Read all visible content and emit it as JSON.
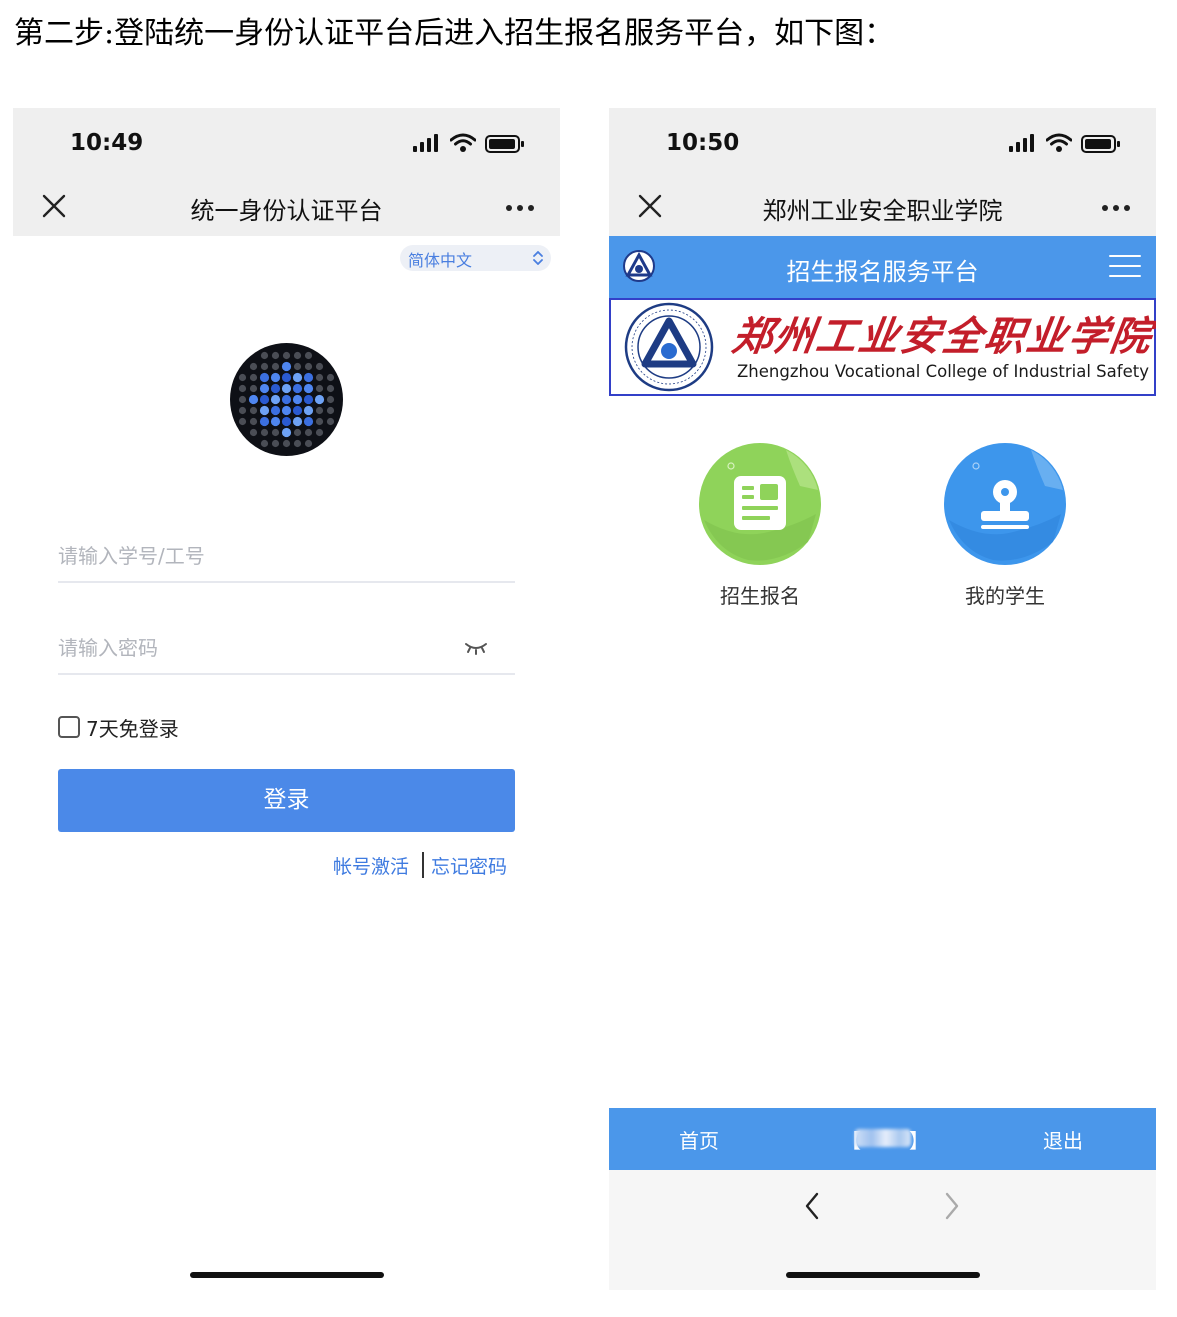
{
  "caption": "第二步:登陆统一身份认证平台后进入招生报名服务平台，如下图：",
  "left_phone": {
    "status_time": "10:49",
    "nav_title": "统一身份认证平台",
    "language": "简体中文",
    "username_placeholder": "请输入学号/工号",
    "password_placeholder": "请输入密码",
    "remember_label": "7天免登录",
    "login_label": "登录",
    "link_activate": "帐号激活",
    "link_forgot": "忘记密码"
  },
  "right_phone": {
    "status_time": "10:50",
    "nav_title": "郑州工业安全职业学院",
    "header_title": "招生报名服务平台",
    "college_name_cn": "郑州工业安全职业学院",
    "college_name_en": "Zhengzhou Vocational College of Industrial Safety",
    "tiles": [
      {
        "label": "招生报名",
        "icon": "document-card-icon",
        "color": "#8fd35a"
      },
      {
        "label": "我的学生",
        "icon": "stamp-icon",
        "color": "#3d96ec"
      }
    ],
    "bottom_tabs": {
      "home": "首页",
      "user_open": "【",
      "user_close": "】",
      "exit": "退出"
    }
  },
  "colors": {
    "primary_blue": "#4b89e8",
    "header_blue": "#4b97ea",
    "link_blue": "#3f7be0",
    "college_red": "#c31e2a"
  }
}
